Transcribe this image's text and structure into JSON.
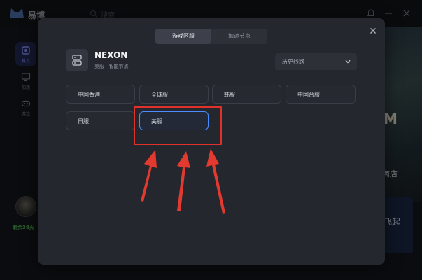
{
  "app": {
    "name": "易博",
    "search_placeholder": "搜索"
  },
  "sidebar": {
    "items": [
      {
        "label": "首页",
        "icon": "home-icon",
        "active": true
      },
      {
        "label": "加速",
        "icon": "monitor-icon",
        "active": false
      },
      {
        "label": "游戏",
        "icon": "gamepad-icon",
        "active": false
      }
    ],
    "remaining": "剩余38天"
  },
  "background": {
    "banner_text": "M",
    "store_label": "商店",
    "boost_label": "飞起"
  },
  "modal": {
    "tabs": [
      {
        "label": "游戏区服",
        "active": true
      },
      {
        "label": "加速节点",
        "active": false
      }
    ],
    "game": {
      "title": "NEXON",
      "subtitle": "美服 · 智能节点",
      "icon": "server-icon"
    },
    "history_select": {
      "label": "历史线路",
      "icon": "chevron-down-icon"
    },
    "regions": [
      {
        "label": "中国香港",
        "selected": false
      },
      {
        "label": "全球服",
        "selected": false
      },
      {
        "label": "韩服",
        "selected": false
      },
      {
        "label": "中国台服",
        "selected": false
      },
      {
        "label": "日服",
        "selected": false
      },
      {
        "label": "美服",
        "selected": true
      }
    ]
  },
  "colors": {
    "accent": "#4a8dff",
    "annotation": "#e0322b",
    "nav_active": "#242a52",
    "modal_bg": "#25272e"
  }
}
